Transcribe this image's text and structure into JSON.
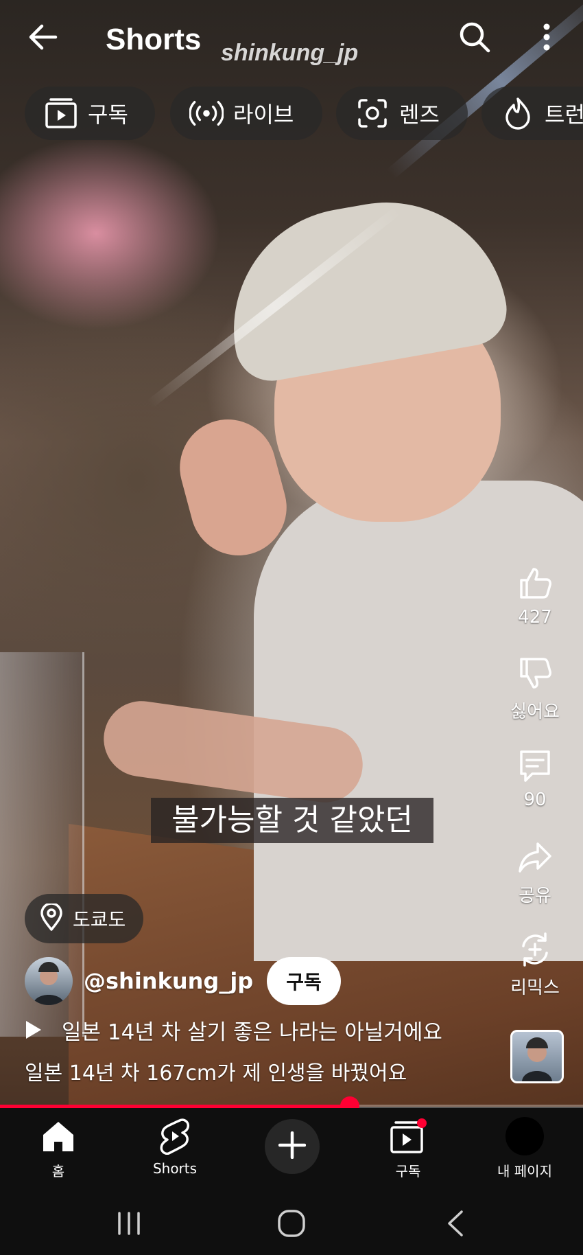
{
  "header": {
    "title": "Shorts",
    "watermark": "shinkung_jp"
  },
  "chips": [
    {
      "label": "구독",
      "icon": "subscriptions-icon"
    },
    {
      "label": "라이브",
      "icon": "live-icon"
    },
    {
      "label": "렌즈",
      "icon": "lens-icon"
    },
    {
      "label": "트런",
      "icon": "trending-icon"
    }
  ],
  "caption": "불가능할 것 같았던",
  "actions": {
    "like_count": "427",
    "dislike_label": "싫어요",
    "comment_count": "90",
    "share_label": "공유",
    "remix_label": "리믹스"
  },
  "location": {
    "label": "도쿄도"
  },
  "channel": {
    "handle": "@shinkung_jp",
    "subscribe_label": "구독"
  },
  "related": {
    "title": "일본 14년 차 살기 좋은 나라는 아닐거에요"
  },
  "description": "일본 14년 차 167cm가 제 인생을 바꿨어요",
  "progress": {
    "fraction": 0.6
  },
  "bottom_nav": [
    {
      "label": "홈",
      "icon": "home-icon"
    },
    {
      "label": "Shorts",
      "icon": "shorts-icon"
    },
    {
      "label": "",
      "icon": "create-icon"
    },
    {
      "label": "구독",
      "icon": "subscriptions-icon"
    },
    {
      "label": "내 페이지",
      "icon": "avatar"
    }
  ],
  "colors": {
    "accent": "#ff0033",
    "background": "#0f0f0f"
  }
}
